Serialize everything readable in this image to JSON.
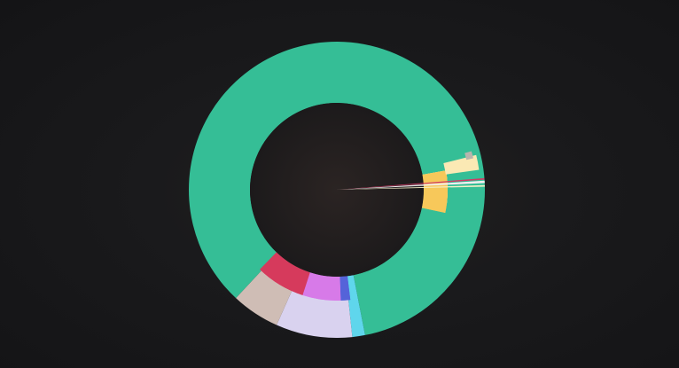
{
  "chart_data": {
    "type": "pie",
    "variant": "sunburst",
    "title": "",
    "legend": "none",
    "grid": false,
    "start_angle_deg": 0,
    "direction": "clockwise",
    "background": "#161618",
    "center_color": "#1e1b1b",
    "segments": [
      {
        "ring": "inner",
        "start_deg": 80,
        "end_deg": 97,
        "color": "#fbe6a7"
      },
      {
        "ring": "inner",
        "start_deg": 80,
        "end_deg": 102,
        "color": "#f7c85a"
      },
      {
        "ring": "inner",
        "start_deg": 173,
        "end_deg": 178,
        "color": "#5563d9"
      },
      {
        "ring": "inner",
        "start_deg": 178,
        "end_deg": 198,
        "color": "#d77ae8"
      },
      {
        "ring": "inner",
        "start_deg": 198,
        "end_deg": 224,
        "color": "#d63a5c"
      },
      {
        "ring": "outer",
        "start_deg": 0,
        "end_deg": 169,
        "color": "#35be96"
      },
      {
        "ring": "outer",
        "start_deg": 169,
        "end_deg": 174,
        "color": "#5fd6ec"
      },
      {
        "ring": "outer",
        "start_deg": 174,
        "end_deg": 204,
        "color": "#d9d2ef"
      },
      {
        "ring": "outer",
        "start_deg": 204,
        "end_deg": 223,
        "color": "#cfbdb5"
      },
      {
        "ring": "outer",
        "start_deg": 223,
        "end_deg": 360,
        "color": "#35be96"
      },
      {
        "ring": "overlay",
        "start_deg": 86.5,
        "end_deg": 87.4,
        "color": "#f3eef0"
      },
      {
        "ring": "overlay",
        "start_deg": 85.5,
        "end_deg": 86.1,
        "color": "#cf3b66"
      },
      {
        "ring": "overlay",
        "start_deg": 88.2,
        "end_deg": 88.8,
        "color": "#f6f0c8"
      },
      {
        "ring": "overlay",
        "start_deg": 76,
        "end_deg": 82,
        "color": "#fbe9b4"
      },
      {
        "ring": "overlay",
        "start_deg": 74,
        "end_deg": 77,
        "color": "#b9b5ad"
      }
    ]
  }
}
